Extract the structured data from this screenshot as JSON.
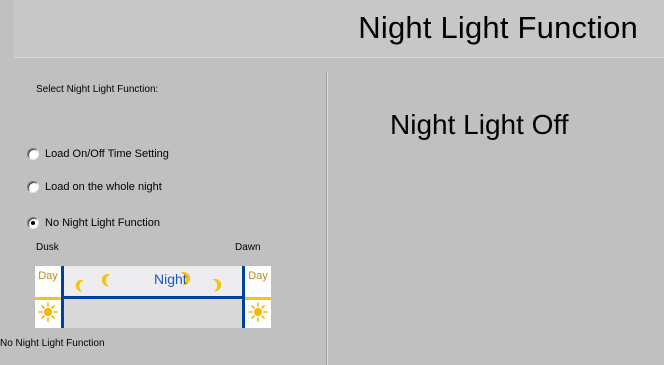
{
  "header": {
    "title": "Night Light Function"
  },
  "left_panel": {
    "section_label": "Select Night Light Function:",
    "options": [
      {
        "label": "Load On/Off Time Setting",
        "checked": false
      },
      {
        "label": "Load on the whole night",
        "checked": false
      },
      {
        "label": "No Night Light Function",
        "checked": true
      }
    ],
    "timeline": {
      "start_label": "Dusk",
      "end_label": "Dawn",
      "left_day_label": "Day",
      "right_day_label": "Day",
      "night_label": "Night"
    },
    "footer": "No Night Light Function"
  },
  "right_panel": {
    "status": "Night Light Off"
  },
  "icons": {
    "radio": "radio-button-icon",
    "sun": "sun-icon",
    "moon": "crescent-moon-icon"
  },
  "colors": {
    "background": "#c0c0c0",
    "title_background": "#c7c7c7",
    "timeline_line": "#00419c",
    "day_accent": "#f5c516",
    "night_text": "#1f58b5"
  }
}
